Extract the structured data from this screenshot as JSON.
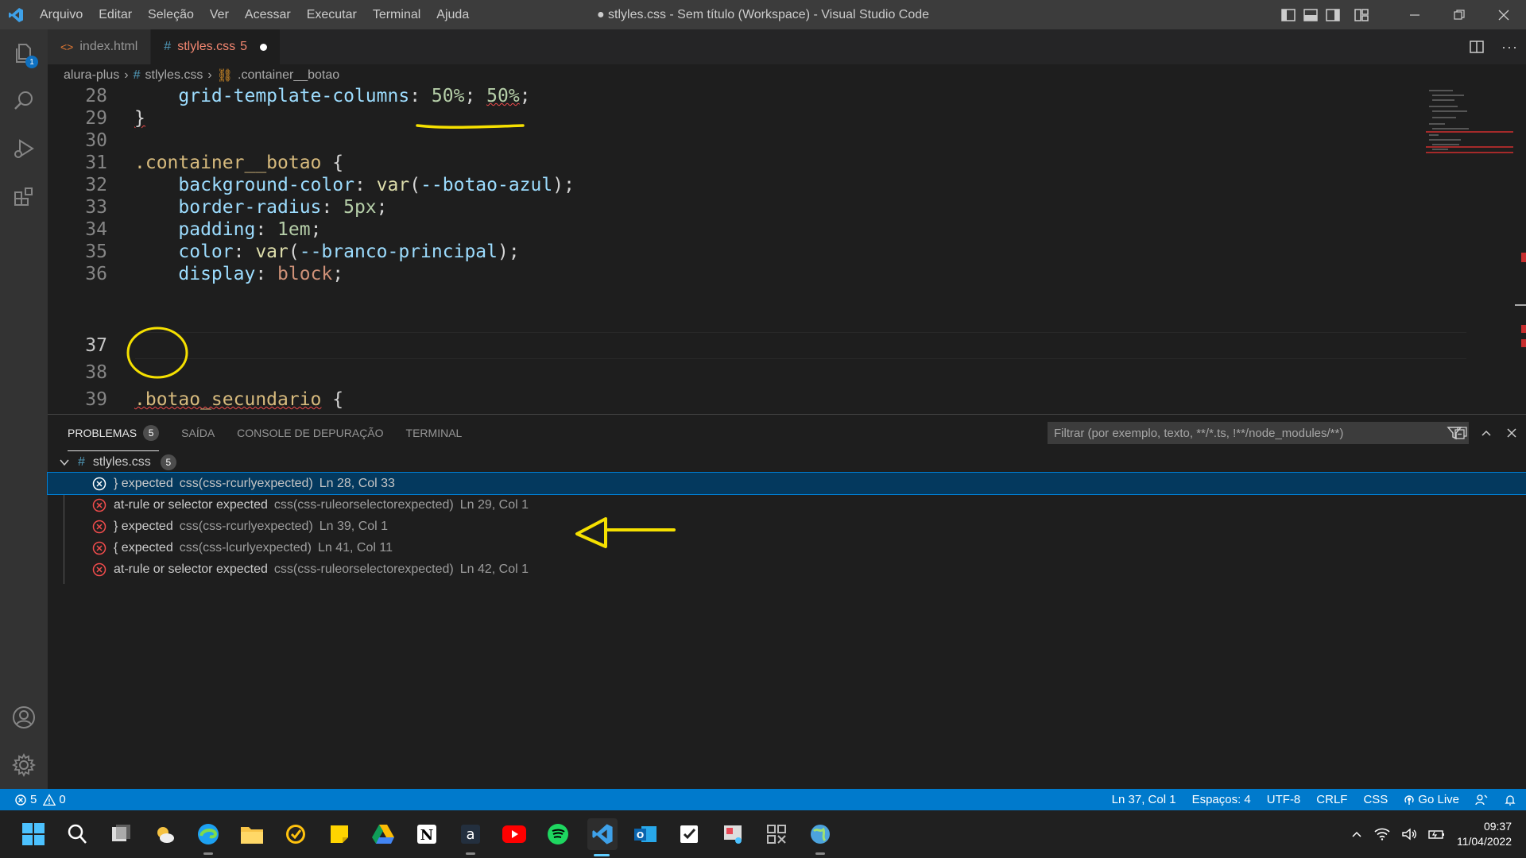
{
  "titlebar": {
    "menu": [
      "Arquivo",
      "Editar",
      "Seleção",
      "Ver",
      "Acessar",
      "Executar",
      "Terminal",
      "Ajuda"
    ],
    "title": "● stlyles.css - Sem título (Workspace) - Visual Studio Code"
  },
  "activitybar": {
    "explorer_badge": "1",
    "colors": {
      "accent": "#0e70c0"
    }
  },
  "tabs": [
    {
      "label": "index.html",
      "icon": "html-icon"
    },
    {
      "label": "stlyles.css",
      "count": "5",
      "icon": "css-icon",
      "modified": true
    }
  ],
  "breadcrumb": {
    "root": "alura-plus",
    "file": "stlyles.css",
    "symbol": ".container__botao"
  },
  "editor": {
    "lines": [
      {
        "n": "28",
        "text": "    grid-template-columns: 50%; 50%;"
      },
      {
        "n": "29",
        "text": "}"
      },
      {
        "n": "30",
        "text": ""
      },
      {
        "n": "31",
        "text": ".container__botao {"
      },
      {
        "n": "32",
        "text": "    background-color: var(--botao-azul);"
      },
      {
        "n": "33",
        "text": "    border-radius: 5px;"
      },
      {
        "n": "34",
        "text": "    padding: 1em;"
      },
      {
        "n": "35",
        "text": "    color: var(--branco-principal);"
      },
      {
        "n": "36",
        "text": "    display: block;"
      },
      {
        "n": "37",
        "text": ""
      },
      {
        "n": "38",
        "text": ""
      },
      {
        "n": "39",
        "text": ".botao_secundario {"
      }
    ],
    "current_line": "37"
  },
  "panel": {
    "tabs": [
      "PROBLEMAS",
      "SAÍDA",
      "CONSOLE DE DEPURAÇÃO",
      "TERMINAL"
    ],
    "problems_count": "5",
    "filter_placeholder": "Filtrar (por exemplo, texto, **/*.ts, !**/node_modules/**)",
    "file": {
      "name": "stlyles.css",
      "count": "5"
    },
    "problems": [
      {
        "message": "} expected",
        "source": "css(css-rcurlyexpected)",
        "location": "Ln 28, Col 33"
      },
      {
        "message": "at-rule or selector expected",
        "source": "css(css-ruleorselectorexpected)",
        "location": "Ln 29, Col 1"
      },
      {
        "message": "} expected",
        "source": "css(css-rcurlyexpected)",
        "location": "Ln 39, Col 1"
      },
      {
        "message": "{ expected",
        "source": "css(css-lcurlyexpected)",
        "location": "Ln 41, Col 11"
      },
      {
        "message": "at-rule or selector expected",
        "source": "css(css-ruleorselectorexpected)",
        "location": "Ln 42, Col 1"
      }
    ]
  },
  "statusbar": {
    "errors": "5",
    "warnings": "0",
    "position": "Ln 37, Col 1",
    "spaces": "Espaços: 4",
    "encoding": "UTF-8",
    "eol": "CRLF",
    "language": "CSS",
    "golive": "Go Live",
    "color": "#007acc"
  },
  "taskbar": {
    "time": "09:37",
    "date": "11/04/2022"
  }
}
